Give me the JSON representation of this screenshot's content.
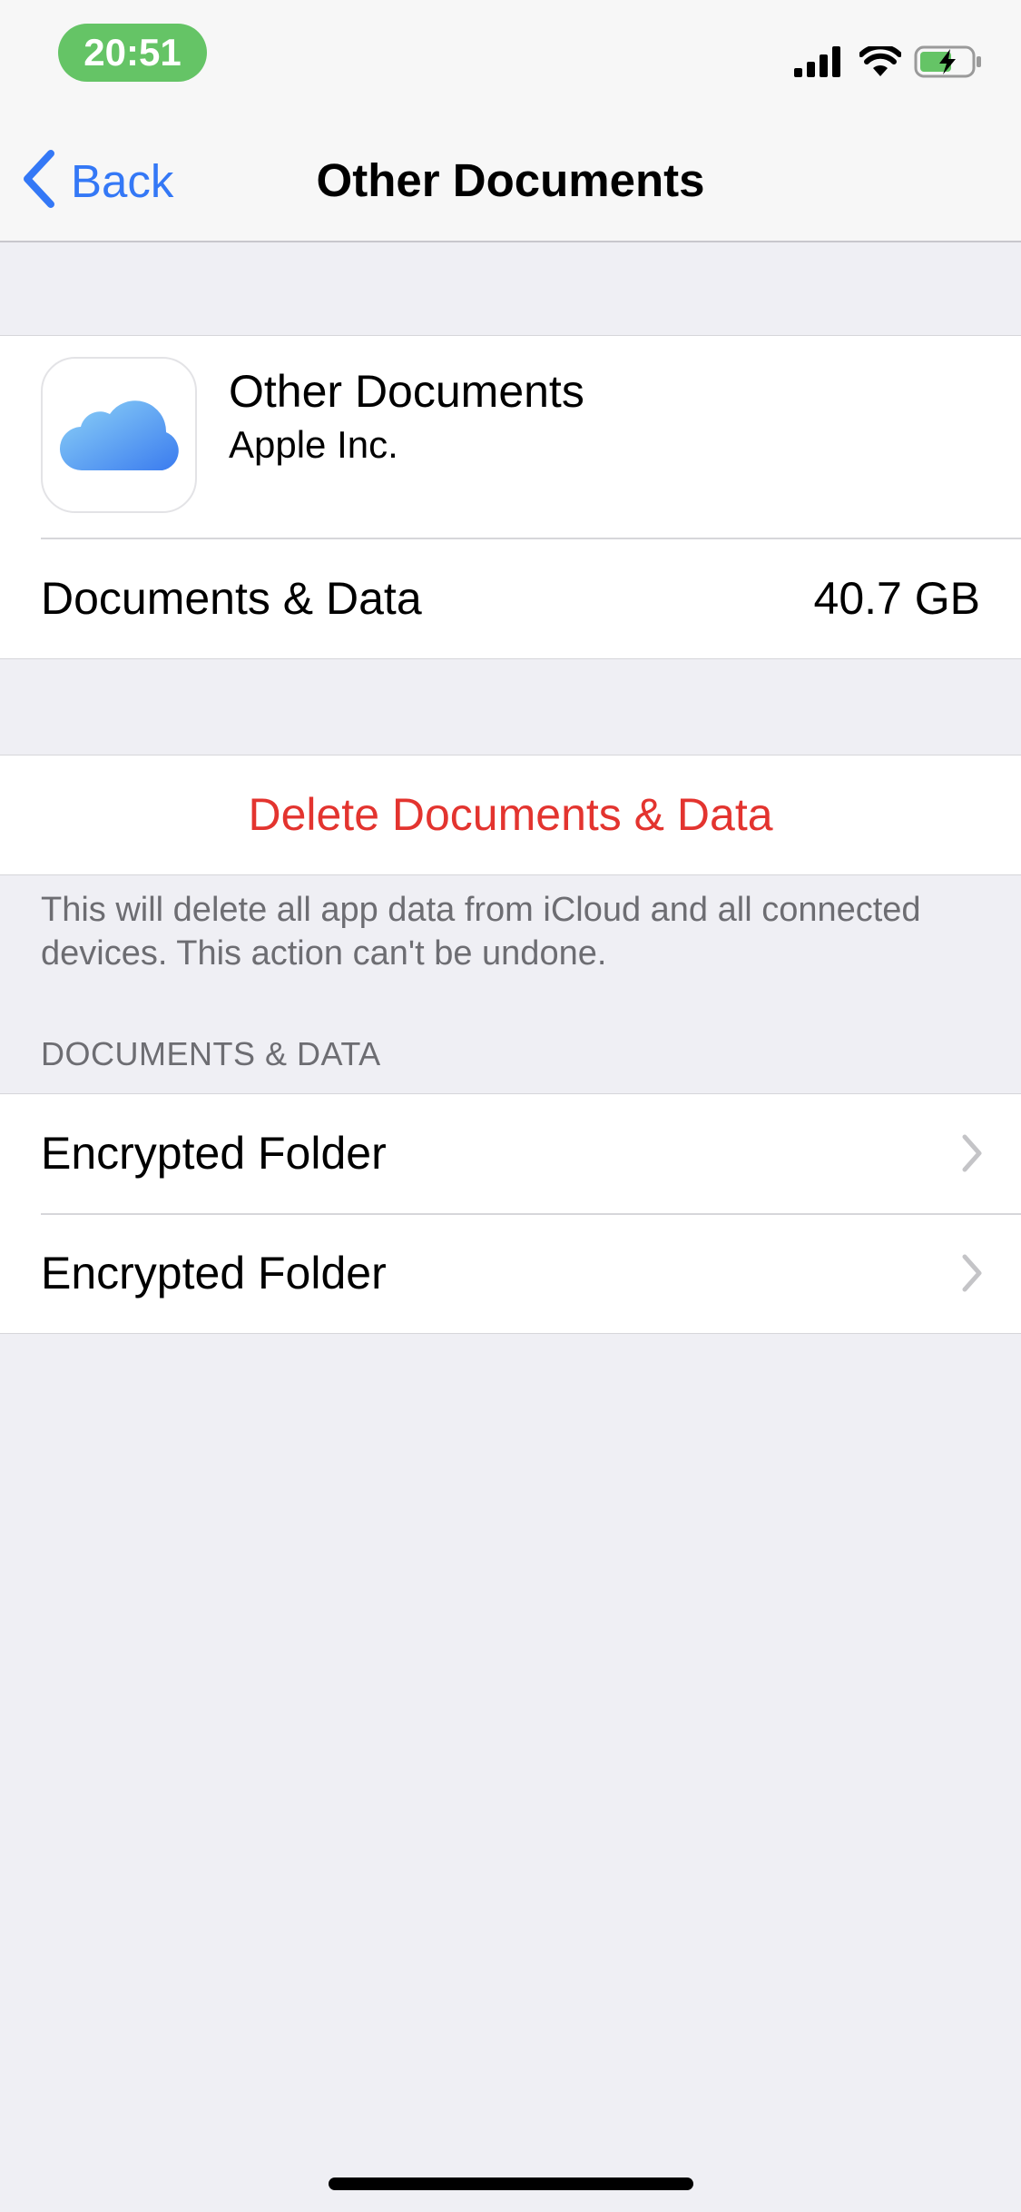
{
  "status_bar": {
    "time": "20:51",
    "icons": [
      "signal-icon",
      "wifi-icon",
      "battery-charging-icon"
    ],
    "pill_color": "#65c466"
  },
  "nav": {
    "back_label": "Back",
    "title": "Other Documents"
  },
  "app": {
    "name": "Other Documents",
    "developer": "Apple Inc.",
    "icon": "icloud-icon"
  },
  "documents_row": {
    "label": "Documents & Data",
    "value": "40.7 GB"
  },
  "delete": {
    "label": "Delete Documents & Data",
    "color": "#e3342f",
    "note": "This will delete all app data from iCloud and all connected devices. This action can't be undone."
  },
  "folders": {
    "header": "DOCUMENTS & DATA",
    "items": [
      {
        "label": "Encrypted Folder"
      },
      {
        "label": "Encrypted Folder"
      }
    ]
  },
  "colors": {
    "accent": "#3478f6",
    "background": "#efeff4"
  }
}
